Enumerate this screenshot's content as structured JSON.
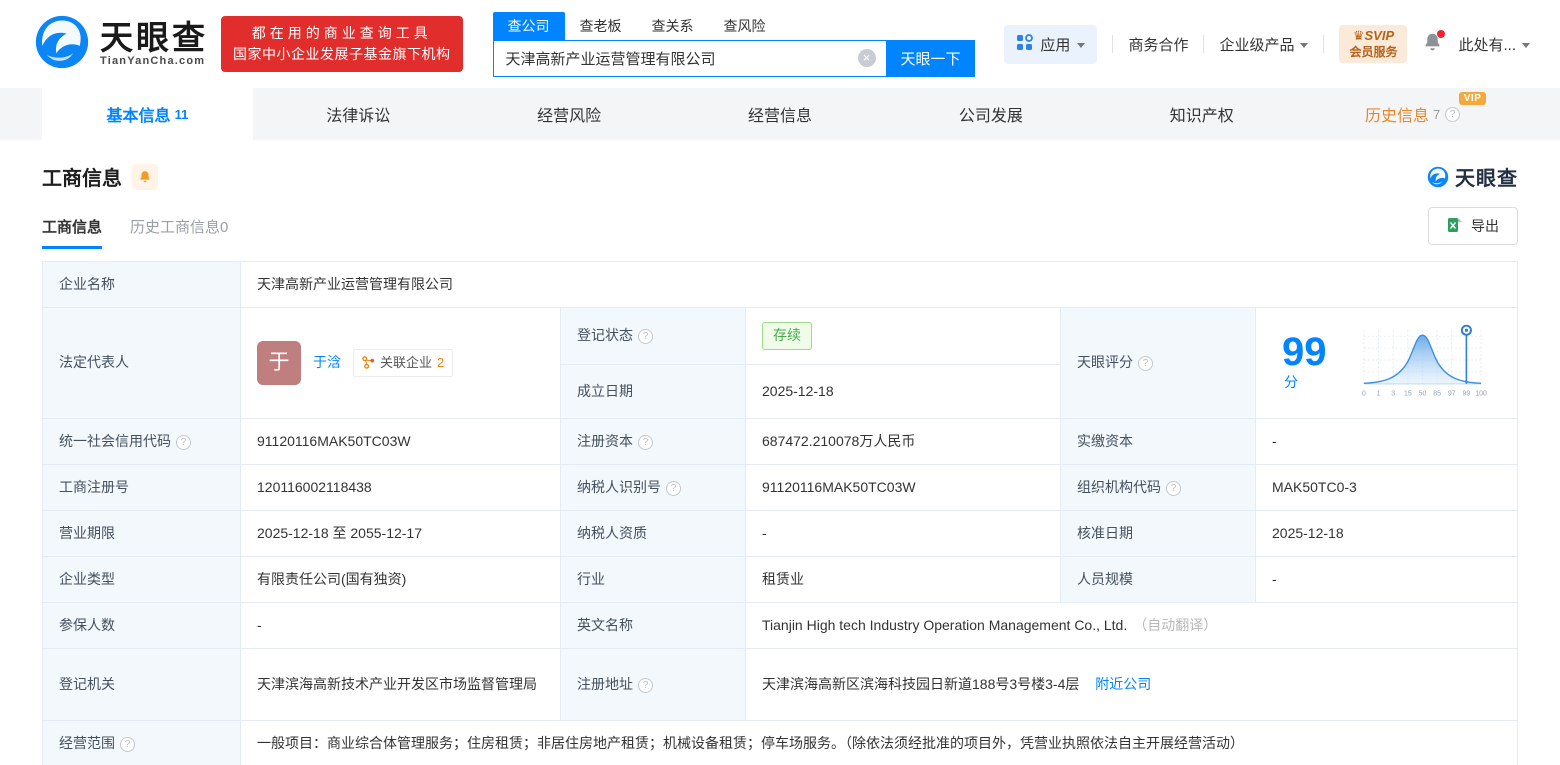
{
  "brand": {
    "name": "天眼查",
    "domain": "TianYanCha.com",
    "slogan_line1": "都在用的商业查询工具",
    "slogan_line2": "国家中小企业发展子基金旗下机构"
  },
  "search": {
    "tabs": [
      {
        "label": "查公司",
        "active": true
      },
      {
        "label": "查老板"
      },
      {
        "label": "查关系"
      },
      {
        "label": "查风险"
      }
    ],
    "value": "天津高新产业运营管理有限公司",
    "button_label": "天眼一下"
  },
  "topnav": {
    "apps_label": "应用",
    "biz_label": "商务合作",
    "enterprise_label": "企业级产品",
    "svip_line1": "SVIP",
    "svip_line2": "会员服务",
    "svip_crown": "♛",
    "more_label": "此处有..."
  },
  "tabs": [
    {
      "label": "基本信息",
      "count": "11"
    },
    {
      "label": "法律诉讼"
    },
    {
      "label": "经营风险"
    },
    {
      "label": "经营信息"
    },
    {
      "label": "公司发展"
    },
    {
      "label": "知识产权"
    },
    {
      "label": "历史信息",
      "count": "7",
      "vip": "VIP"
    }
  ],
  "section": {
    "title": "工商信息",
    "subtabs": [
      {
        "label": "工商信息",
        "active": true
      },
      {
        "label": "历史工商信息",
        "count": "0"
      }
    ],
    "export_label": "导出",
    "watermark": "天眼查"
  },
  "fields": {
    "company_name": {
      "label": "企业名称",
      "value": "天津高新产业运营管理有限公司"
    },
    "legal_rep": {
      "label": "法定代表人",
      "avatar_text": "于",
      "name": "于浛",
      "badge_label": "关联企业",
      "badge_count": "2"
    },
    "reg_status": {
      "label": "登记状态",
      "value": "存续"
    },
    "establish_date": {
      "label": "成立日期",
      "value": "2025-12-18"
    },
    "score": {
      "label": "天眼评分",
      "value": "99",
      "unit": "分"
    },
    "credit_code": {
      "label": "统一社会信用代码",
      "value": "91120116MAK50TC03W"
    },
    "reg_capital": {
      "label": "注册资本",
      "value": "687472.210078万人民币"
    },
    "paid_capital": {
      "label": "实缴资本",
      "value": "-"
    },
    "reg_number": {
      "label": "工商注册号",
      "value": "120116002118438"
    },
    "taxpayer_id": {
      "label": "纳税人识别号",
      "value": "91120116MAK50TC03W"
    },
    "org_code": {
      "label": "组织机构代码",
      "value": "MAK50TC0-3"
    },
    "business_term": {
      "label": "营业期限",
      "value": "2025-12-18 至 2055-12-17"
    },
    "taxpayer_quality": {
      "label": "纳税人资质",
      "value": "-"
    },
    "approval_date": {
      "label": "核准日期",
      "value": "2025-12-18"
    },
    "company_type": {
      "label": "企业类型",
      "value": "有限责任公司(国有独资)"
    },
    "industry": {
      "label": "行业",
      "value": "租赁业"
    },
    "staff_size": {
      "label": "人员规模",
      "value": "-"
    },
    "insured_count": {
      "label": "参保人数",
      "value": "-"
    },
    "english_name": {
      "label": "英文名称",
      "value": "Tianjin High tech Industry Operation Management Co., Ltd.",
      "note": "（自动翻译）"
    },
    "reg_authority": {
      "label": "登记机关",
      "value": "天津滨海高新技术产业开发区市场监督管理局"
    },
    "reg_address": {
      "label": "注册地址",
      "value": "天津滨海高新区滨海科技园日新道188号3号楼3-4层",
      "link_label": "附近公司"
    },
    "business_scope": {
      "label": "经营范围",
      "value": "一般项目：商业综合体管理服务；住房租赁；非居住房地产租赁；机械设备租赁；停车场服务。（除依法须经批准的项目外，凭营业执照依法自主开展经营活动）"
    }
  },
  "chart_data": {
    "type": "area",
    "title": "天眼评分分布曲线",
    "score": 99,
    "score_unit": "分",
    "x_ticks": [
      "0",
      "1",
      "3",
      "15",
      "50",
      "85",
      "97",
      "99",
      "100"
    ],
    "marker_tick": "99",
    "curve_shape": "bell",
    "grid": true
  },
  "icons": {
    "help_glyph": "?",
    "clear_glyph": "×"
  },
  "colors": {
    "brand_blue": "#0084ff",
    "banner_red": "#e22d2d",
    "status_green": "#44ad49",
    "accent_orange": "#e7872c",
    "vip_orange": "#f5a93a",
    "label_cell_bg": "#f2f8fc",
    "tabbar_bg": "#f3f5f7"
  }
}
